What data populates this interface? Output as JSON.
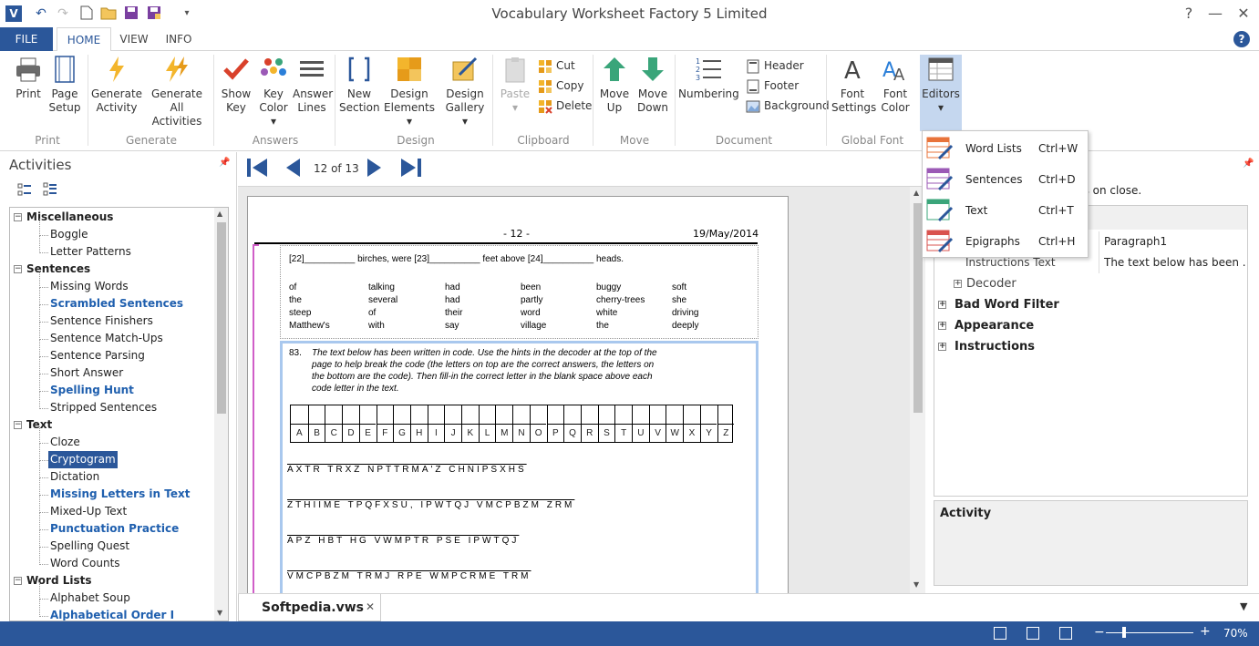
{
  "window": {
    "title": "Vocabulary Worksheet Factory 5 Limited",
    "app_icon": "V"
  },
  "ribbon_tabs": [
    {
      "label": "FILE"
    },
    {
      "label": "HOME"
    },
    {
      "label": "VIEW"
    },
    {
      "label": "INFO"
    }
  ],
  "ribbon": {
    "print": {
      "l1": "Print"
    },
    "page_setup": {
      "l1": "Page",
      "l2": "Setup"
    },
    "generate_activity": {
      "l1": "Generate",
      "l2": "Activity"
    },
    "generate_all": {
      "l1": "Generate",
      "l2": "All Activities"
    },
    "show_key": {
      "l1": "Show",
      "l2": "Key"
    },
    "key_color": {
      "l1": "Key",
      "l2": "Color ▾"
    },
    "answer_lines": {
      "l1": "Answer",
      "l2": "Lines"
    },
    "new_section": {
      "l1": "New",
      "l2": "Section"
    },
    "design_elements": {
      "l1": "Design",
      "l2": "Elements ▾"
    },
    "design_gallery": {
      "l1": "Design",
      "l2": "Gallery ▾"
    },
    "paste": {
      "l1": "Paste",
      "l2": "▾"
    },
    "cut": "Cut",
    "copy": "Copy",
    "delete": "Delete",
    "move_up": {
      "l1": "Move",
      "l2": "Up"
    },
    "move_down": {
      "l1": "Move",
      "l2": "Down"
    },
    "numbering": {
      "l1": "Numbering"
    },
    "header": "Header",
    "footer": "Footer",
    "background": "Background",
    "font_settings": {
      "l1": "Font",
      "l2": "Settings"
    },
    "font_color": {
      "l1": "Font",
      "l2": "Color"
    },
    "editors": {
      "l1": "Editors",
      "l2": "▾"
    },
    "groups": {
      "print": "Print",
      "generate": "Generate",
      "answers": "Answers",
      "design": "Design",
      "clipboard": "Clipboard",
      "move": "Move",
      "document": "Document",
      "global_font": "Global Font"
    }
  },
  "editors_menu": [
    {
      "label": "Word Lists",
      "shortcut": "Ctrl+W",
      "color": "#e8733a"
    },
    {
      "label": "Sentences",
      "shortcut": "Ctrl+D",
      "color": "#9b59b6"
    },
    {
      "label": "Text",
      "shortcut": "Ctrl+T",
      "color": "#3aa57a"
    },
    {
      "label": "Epigraphs",
      "shortcut": "Ctrl+H",
      "color": "#d9534f"
    }
  ],
  "activities": {
    "title": "Activities",
    "tree": [
      {
        "label": "Miscellaneous",
        "type": "cat"
      },
      {
        "label": "Boggle",
        "type": "item"
      },
      {
        "label": "Letter Patterns",
        "type": "item"
      },
      {
        "label": "Sentences",
        "type": "cat"
      },
      {
        "label": "Missing Words",
        "type": "item"
      },
      {
        "label": "Scrambled Sentences",
        "type": "bold"
      },
      {
        "label": "Sentence Finishers",
        "type": "item"
      },
      {
        "label": "Sentence Match-Ups",
        "type": "item"
      },
      {
        "label": "Sentence Parsing",
        "type": "item"
      },
      {
        "label": "Short Answer",
        "type": "item"
      },
      {
        "label": "Spelling Hunt",
        "type": "bold"
      },
      {
        "label": "Stripped Sentences",
        "type": "item"
      },
      {
        "label": "Text",
        "type": "cat"
      },
      {
        "label": "Cloze",
        "type": "item"
      },
      {
        "label": "Cryptogram",
        "type": "sel"
      },
      {
        "label": "Dictation",
        "type": "item"
      },
      {
        "label": "Missing Letters in Text",
        "type": "bold"
      },
      {
        "label": "Mixed-Up Text",
        "type": "item"
      },
      {
        "label": "Punctuation Practice",
        "type": "bold"
      },
      {
        "label": "Spelling Quest",
        "type": "item"
      },
      {
        "label": "Word Counts",
        "type": "item"
      },
      {
        "label": "Word Lists",
        "type": "cat"
      },
      {
        "label": "Alphabet Soup",
        "type": "item"
      },
      {
        "label": "Alphabetical Order I",
        "type": "bold"
      }
    ]
  },
  "navigation": {
    "page_indicator": "12 of 13"
  },
  "document": {
    "page_number": "- 12 -",
    "date": "19/May/2014",
    "sentence": "[22]__________ birches, were [23]__________ feet above [24]__________ heads.",
    "word_bank": [
      [
        "of",
        "talking",
        "had",
        "been",
        "buggy",
        "soft"
      ],
      [
        "the",
        "several",
        "had",
        "partly",
        "cherry-trees",
        "she"
      ],
      [
        "steep",
        "of",
        "their",
        "word",
        "white",
        "driving"
      ],
      [
        "Matthew's",
        "with",
        "say",
        "village",
        "the",
        "deeply"
      ]
    ],
    "question_number": "83.",
    "instruction_lines": [
      "The text below has been written in code. Use the hints in the decoder at the top of the",
      "page to help break the code (the letters on top are the correct answers, the letters on",
      "the bottom are the code). Then fill-in the correct letter in the blank space above each",
      "code letter in the text."
    ],
    "decoder_letters": [
      "A",
      "B",
      "C",
      "D",
      "E",
      "F",
      "G",
      "H",
      "I",
      "J",
      "K",
      "L",
      "M",
      "N",
      "O",
      "P",
      "Q",
      "R",
      "S",
      "T",
      "U",
      "V",
      "W",
      "X",
      "Y",
      "Z"
    ],
    "code_lines": [
      "AXTR  TRXZ  NPTTRMA'Z  CHNIPSXHS",
      "ZTHIIME  TPQFXSU,  IPWTQJ  VMCPBZM  ZRM",
      "APZ  HBT  HG  VWMPTR  PSE  IPWTQJ",
      "VMCPBZM  TRMJ  RPE  WMPCRME  TRM"
    ]
  },
  "doc_tab": {
    "label": "Softpedia.vws",
    "close": "✕"
  },
  "properties": {
    "note": "ns on close.",
    "rows": [
      {
        "key": "",
        "value": "Paragraph1"
      },
      {
        "key": "Instructions Text",
        "value": "The text below has been ..."
      }
    ],
    "groups": [
      {
        "label": "Decoder",
        "sub": true
      },
      {
        "label": "Bad Word Filter"
      },
      {
        "label": "Appearance"
      },
      {
        "label": "Instructions"
      }
    ],
    "activity_title": "Activity"
  },
  "statusbar": {
    "zoom": "70%"
  }
}
